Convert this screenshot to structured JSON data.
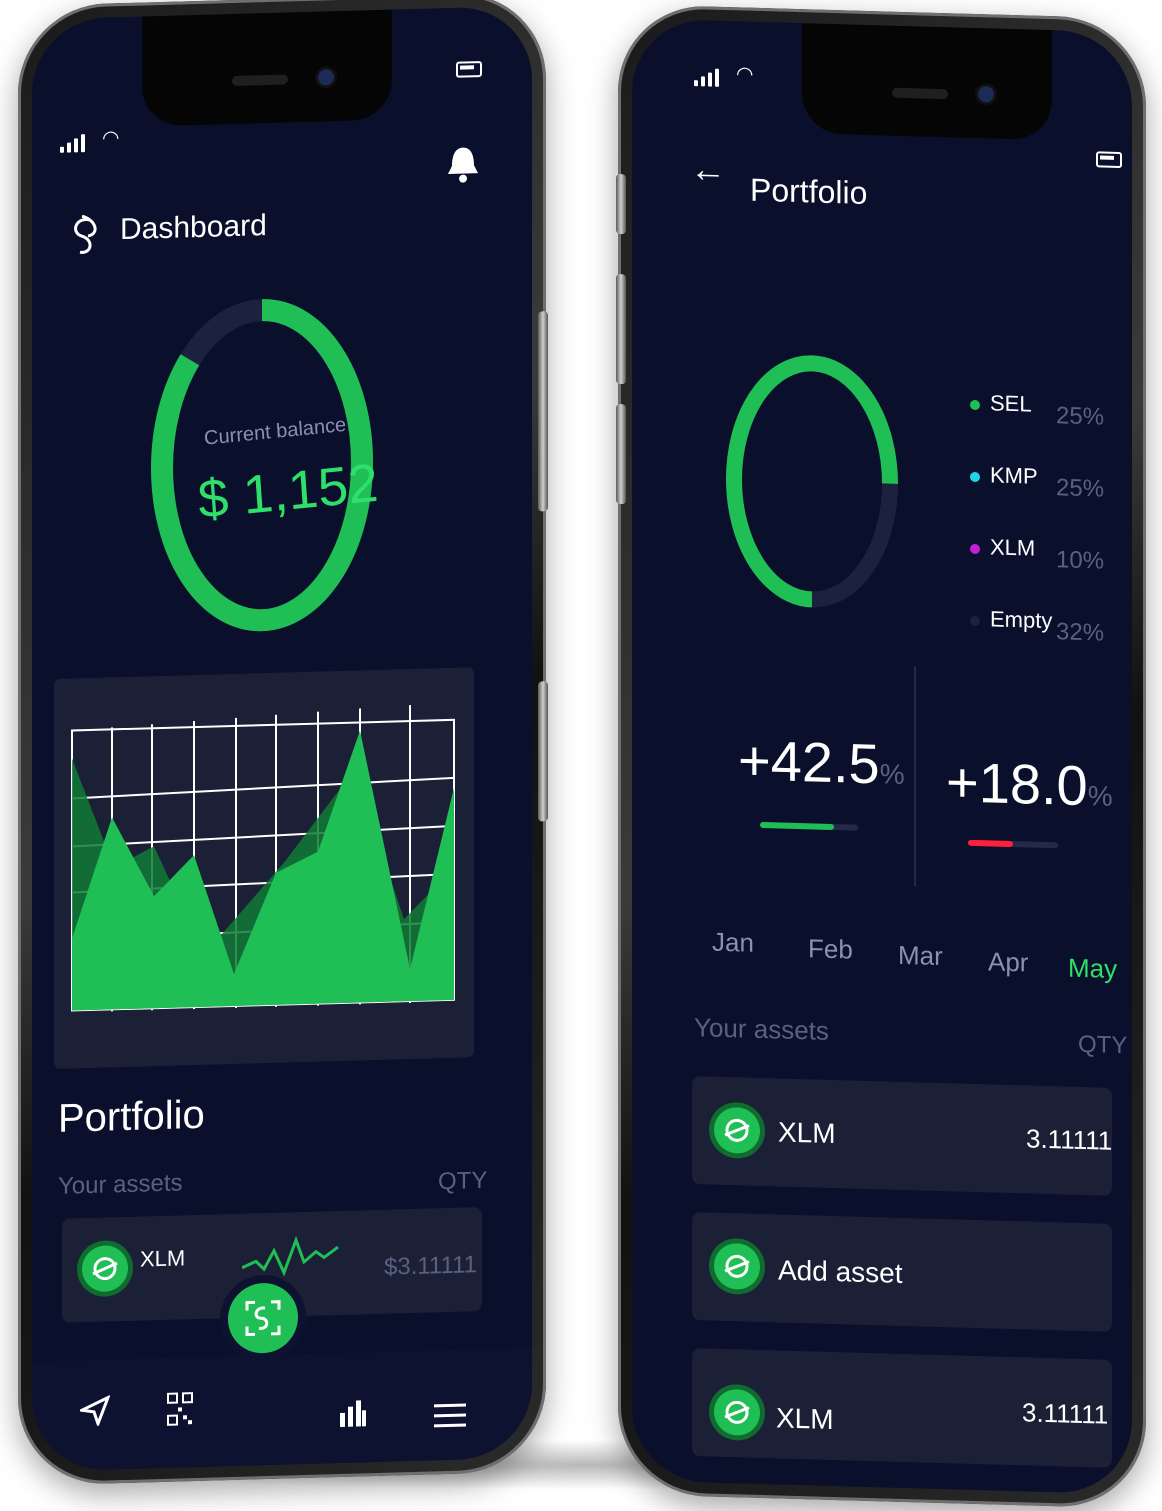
{
  "left_phone": {
    "header": {
      "title": "Dashboard",
      "logo_icon": "chain-link-logo-icon",
      "bell_icon": "bell-icon"
    },
    "balance": {
      "label": "Current balance",
      "value": "$ 1,152",
      "ring_fill_fraction": 0.75,
      "ring_color": "#1fbf55"
    },
    "portfolio": {
      "title": "Portfolio",
      "assets_label": "Your assets",
      "qty_label": "QTY",
      "asset": {
        "name": "XLM",
        "value": "$3.11111"
      }
    },
    "bottom_nav": {
      "items": [
        "send-icon",
        "qr-code-icon",
        "scan-icon",
        "stats-icon",
        "menu-icon"
      ]
    }
  },
  "right_phone": {
    "header": {
      "title": "Portfolio",
      "back_icon": "arrow-left-icon"
    },
    "allocation": {
      "ring_fill_fraction": 0.68,
      "legend": [
        {
          "name": "SEL",
          "percent": "25%",
          "color": "#1fbf55"
        },
        {
          "name": "KMP",
          "percent": "25%",
          "color": "#1fd6e8"
        },
        {
          "name": "XLM",
          "percent": "10%",
          "color": "#c21fd6"
        },
        {
          "name": "Empty",
          "percent": "32%",
          "color": "#1c2140"
        }
      ]
    },
    "stats": [
      {
        "value": "+42.5",
        "unit": "%",
        "bar_fraction": 0.75,
        "bar_color": "#1fbf55"
      },
      {
        "value": "+18.0",
        "unit": "%",
        "bar_fraction": 0.5,
        "bar_color": "#ff1f3a"
      }
    ],
    "months": [
      "Jan",
      "Feb",
      "Mar",
      "Apr",
      "May"
    ],
    "active_month": "May",
    "assets_label": "Your assets",
    "qty_label": "QTY",
    "rows": [
      {
        "name": "XLM",
        "qty": "3.11111"
      },
      {
        "name": "Add asset",
        "qty": ""
      },
      {
        "name": "XLM",
        "qty": "3.11111"
      }
    ]
  }
}
